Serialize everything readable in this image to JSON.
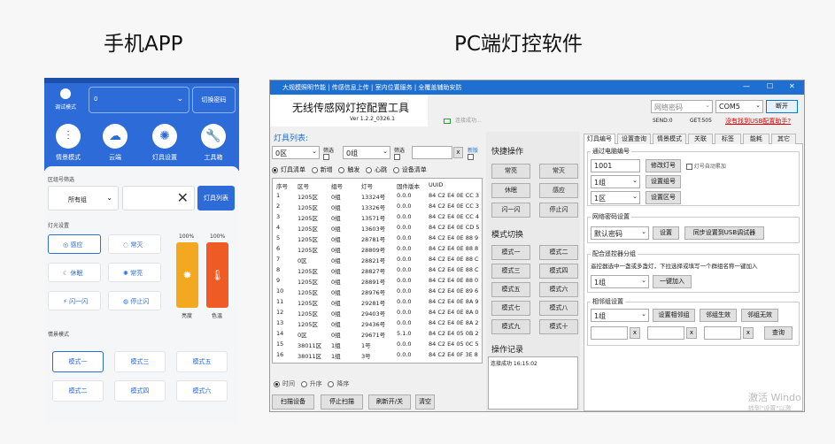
{
  "titles": {
    "mobile": "手机APP",
    "pc": "PC端灯控软件"
  },
  "phone": {
    "device_label": "调试模式",
    "group_select": "0",
    "switch_password": "切换密码",
    "tools": [
      {
        "label": "情景模式",
        "icon": "sliders-icon"
      },
      {
        "label": "云端",
        "icon": "cloud-icon"
      },
      {
        "label": "灯具设置",
        "icon": "sun-icon"
      },
      {
        "label": "工具箱",
        "icon": "wrench-icon"
      }
    ],
    "zone_filter_label": "区组号筛选",
    "zone_select": "所有组",
    "light_list": "灯具列表",
    "light_settings_label": "灯光设置",
    "light_buttons": [
      "感应",
      "常灭",
      "休眠",
      "常亮",
      "闪一闪",
      "停止闪"
    ],
    "brightness_pct": "100%",
    "color_temp_pct": "100%",
    "brightness": 1.0,
    "color_temp": 1.0,
    "brightness_label": "亮度",
    "color_temp_label": "色温",
    "scene_label": "情景模式",
    "scene_buttons": [
      "模式一",
      "模式三",
      "模式五",
      "模式二",
      "模式四",
      "模式六"
    ]
  },
  "pc": {
    "window_title": "大规模照明节能 | 传感信息上传 | 室内位置服务 | 全覆盖辅助安防",
    "app_name": "无线传感网灯控配置工具",
    "version": "Ver 1.2.2_0326.1",
    "connection": "连接成功...",
    "password_select": "网络密码",
    "com_select": "COM5",
    "disconnect": "断开",
    "send": "SEND:0",
    "get": "GET:505",
    "usb_link": "没有找到USB配置助手?",
    "list_title": "灯具列表:",
    "zone_select": "0区",
    "zone_filter": "筛选",
    "group_select": "0组",
    "group_filter": "筛选",
    "clear_x": "x",
    "new_label": "新版",
    "radios": [
      "灯具清单",
      "新增",
      "触发",
      "心跳",
      "设备清单"
    ],
    "columns": [
      "序号",
      "区号",
      "组号",
      "灯号",
      "固件版本",
      "UUID"
    ],
    "rows": [
      [
        "1",
        "1205区",
        "0组",
        "13324号",
        "0.0.0",
        "84 C2 E4 0E CC 3"
      ],
      [
        "2",
        "1205区",
        "0组",
        "13326号",
        "0.0.0",
        "84 C2 E4 0E CC 3"
      ],
      [
        "3",
        "1205区",
        "0组",
        "13571号",
        "0.0.0",
        "84 C2 E4 0E CC 4"
      ],
      [
        "4",
        "1205区",
        "0组",
        "13603号",
        "0.0.0",
        "84 C2 E4 0E CD 5"
      ],
      [
        "5",
        "1205区",
        "0组",
        "28781号",
        "0.0.0",
        "84 C2 E4 0E 88 9"
      ],
      [
        "6",
        "1205区",
        "0组",
        "28809号",
        "0.0.0",
        "84 C2 E4 0E 88 8"
      ],
      [
        "7",
        "0区",
        "0组",
        "28821号",
        "0.0.0",
        "84 C2 E4 0E 88 C"
      ],
      [
        "8",
        "1205区",
        "0组",
        "28827号",
        "0.0.0",
        "84 C2 E4 0E 88 C"
      ],
      [
        "9",
        "1205区",
        "0组",
        "28891号",
        "0.0.0",
        "84 C2 E4 0E 88 0"
      ],
      [
        "10",
        "1205区",
        "0组",
        "28976号",
        "0.0.0",
        "84 C2 E4 0E 89 6"
      ],
      [
        "11",
        "1205区",
        "0组",
        "29281号",
        "0.0.0",
        "84 C2 E4 0E 8A 9"
      ],
      [
        "12",
        "1205区",
        "0组",
        "29403号",
        "0.0.0",
        "84 C2 E4 0E 8A 0"
      ],
      [
        "13",
        "1205区",
        "0组",
        "29436号",
        "0.0.0",
        "84 C2 E4 0E 8A 2"
      ],
      [
        "14",
        "0区",
        "0组",
        "29671号",
        "5.1.0",
        "84 C2 E4 05 0B 2"
      ],
      [
        "15",
        "38011区",
        "1组",
        "1号",
        "0.0.0",
        "84 C2 E4 05 0C 5"
      ],
      [
        "16",
        "38011区",
        "1组",
        "3号",
        "0.0.0",
        "84 C2 E4 0F 3E 8"
      ]
    ],
    "sort_radios": [
      "时间",
      "升序",
      "降序"
    ],
    "bottom_buttons": [
      "扫描设备",
      "停止扫描",
      "刷新开/关",
      "清空"
    ],
    "quick_title": "快捷操作",
    "quick_buttons": [
      "常亮",
      "常灭",
      "休眠",
      "感应",
      "闪一闪",
      "停止闪"
    ],
    "mode_title": "模式切换",
    "mode_buttons": [
      "模式一",
      "模式二",
      "模式三",
      "模式四",
      "模式五",
      "模式六",
      "模式七",
      "模式八",
      "模式九",
      "模式十"
    ],
    "log_title": "操作记录",
    "log_text": "连接成功 16:15:02",
    "tabs": [
      "灯具编号",
      "设置查询",
      "情景模式",
      "关联",
      "标签",
      "能耗",
      "其它"
    ],
    "by_pc_title": "通过电脑编号",
    "light_id": "1001",
    "modify_btn": "修改灯号",
    "auto_inc": "灯号自动累加",
    "group_sel": "1组",
    "set_group_btn": "设置组号",
    "zone_sel": "1区",
    "set_zone_btn": "设置区号",
    "net_pw_title": "网络密码设置",
    "pw_sel": "默认密码",
    "set_btn": "设置",
    "sync_btn": "同步设置到USB调试器",
    "remote_title": "配合遥控器分组",
    "remote_desc": "遥控器选中一盏或多盏灯，下拉选择或填写一个群组名称一键加入",
    "remote_group": "1组",
    "join_btn": "一键加入",
    "adj_title": "相邻组设置",
    "adj_group": "1组",
    "set_adj_btn": "设置相邻组",
    "adj_on_btn": "邻组生效",
    "adj_off_btn": "邻组无效",
    "query_btn": "查询",
    "watermark1": "激活 Windo",
    "watermark2": "转到\"设置\"以激"
  },
  "colors": {
    "accent": "#2c6bd8",
    "orange": "#f4a81f",
    "red": "#ef5b24",
    "pc_title": "#1d6fd1"
  }
}
